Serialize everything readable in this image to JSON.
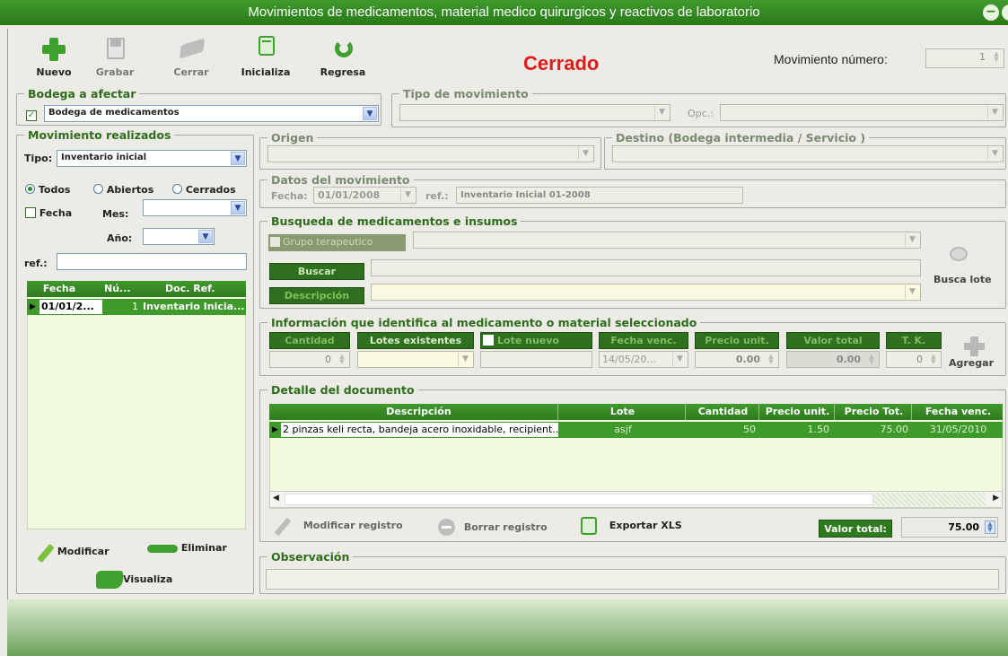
{
  "window": {
    "title": "Movimientos de medicamentos, material medico quirurgicos y reactivos de laboratorio"
  },
  "toolbar": {
    "nuevo": "Nuevo",
    "grabar": "Grabar",
    "cerrar": "Cerrar",
    "inicializa": "Inicializa",
    "regresa": "Regresa"
  },
  "status": "Cerrado",
  "mov_numero": {
    "label": "Movimiento número:",
    "value": "1"
  },
  "bodega": {
    "title": "Bodega a afectar",
    "value": "Bodega de medicamentos"
  },
  "tipo_mov": {
    "title": "Tipo de movimiento",
    "opc_label": "Opc.:"
  },
  "realizados": {
    "title": "Movimiento realizados",
    "tipo_label": "Tipo:",
    "tipo_value": "Inventario inicial",
    "todos": "Todos",
    "abiertos": "Abiertos",
    "cerrados": "Cerrados",
    "fecha": "Fecha",
    "mes": "Mes:",
    "anio": "Año:",
    "ref": "ref.:",
    "columns": [
      "Fecha",
      "Nú...",
      "Doc. Ref."
    ],
    "row": {
      "fecha": "01/01/2...",
      "num": "1",
      "doc": "Inventario Inicia..."
    },
    "modificar": "Modificar",
    "eliminar": "Eliminar",
    "visualiza": "Visualiza"
  },
  "origen": {
    "title": "Origen"
  },
  "destino": {
    "title": "Destino (Bodega intermedia / Servicio )"
  },
  "datos": {
    "title": "Datos del movimiento",
    "fecha_label": "Fecha:",
    "fecha_value": "01/01/2008",
    "ref_label": "ref.:",
    "ref_value": "Inventario Inicial 01-2008"
  },
  "busqueda": {
    "title": "Busqueda de medicamentos e insumos",
    "grupo": "Grupo terapeutico",
    "buscar": "Buscar",
    "descripcion": "Descripción",
    "busca_lote": "Busca lote"
  },
  "info": {
    "title": "Información que identifica al medicamento o material seleccionado",
    "cantidad": "Cantidad",
    "lotes": "Lotes existentes",
    "lote_nuevo": "Lote nuevo",
    "fecha_venc": "Fecha venc.",
    "precio_unit": "Precio unit.",
    "valor_total": "Valor total",
    "tk": "T. K.",
    "cantidad_val": "0",
    "fecha_val": "14/05/20...",
    "precio_val": "0.00",
    "valor_val": "0.00",
    "tk_val": "0",
    "agregar": "Agregar"
  },
  "detalle": {
    "title": "Detalle del documento",
    "columns": [
      "Descripción",
      "Lote",
      "Cantidad",
      "Precio unit.",
      "Precio Tot.",
      "Fecha venc."
    ],
    "rows": [
      {
        "descripcion": "2 pinzas keli recta, bandeja acero inoxidable, recipient...",
        "lote": "asjf",
        "cantidad": "50",
        "precio_unit": "1.50",
        "precio_tot": "75.00",
        "fecha_venc": "31/05/2010"
      }
    ],
    "modificar": "Modificar registro",
    "borrar": "Borrar registro",
    "exportar": "Exportar XLS",
    "valor_total_label": "Valor total:",
    "valor_total": "75.00"
  },
  "observacion": {
    "title": "Observación"
  }
}
